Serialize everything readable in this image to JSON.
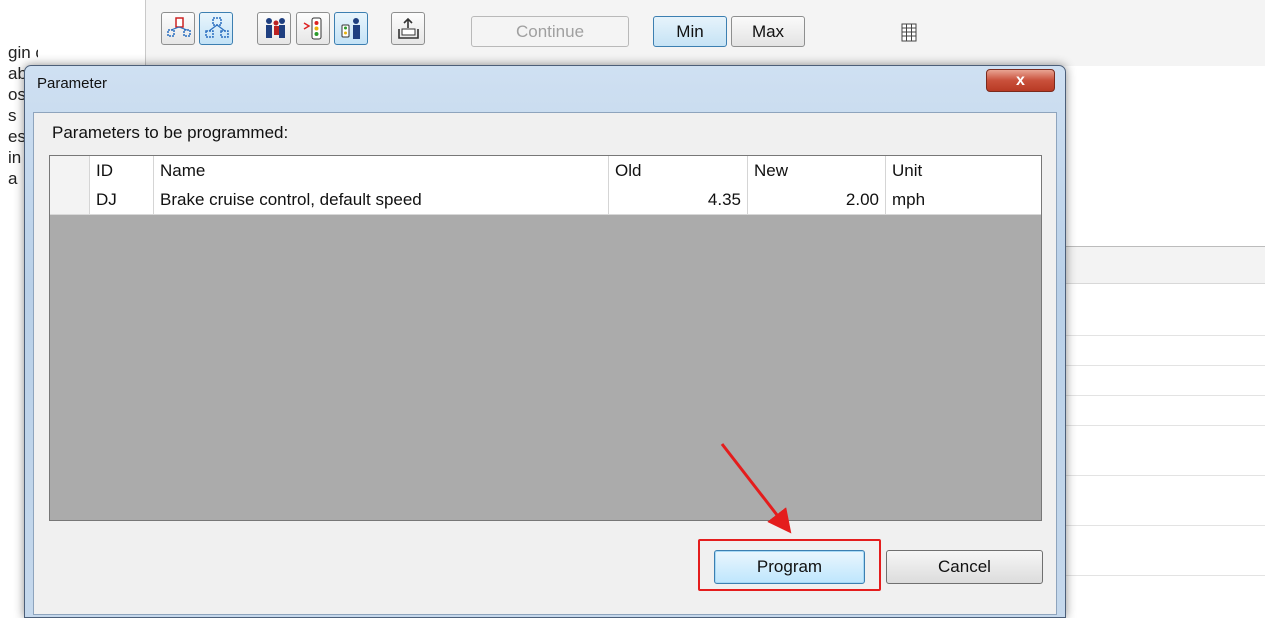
{
  "toolbar": {
    "continue_label": "Continue",
    "min_label": "Min",
    "max_label": "Max",
    "icons": [
      "flow-chart-icon",
      "flow-chart-dots-icon",
      "people-icon",
      "traffic-light-icon",
      "person-signal-icon",
      "upload-icon",
      "grid-table-icon"
    ]
  },
  "background": {
    "left_text_lines": [
      "gin operation",
      "ab",
      "os",
      "s",
      "es",
      "in",
      "a"
    ]
  },
  "dialog": {
    "title": "Parameter",
    "close_label": "x",
    "params_label": "Parameters to be programmed:",
    "columns": [
      "ID",
      "Name",
      "Old",
      "New",
      "Unit"
    ],
    "rows": [
      {
        "id": "DJ",
        "name": "Brake cruise control, default speed",
        "old": "4.35",
        "new": "2.00",
        "unit": "mph"
      }
    ],
    "program_label": "Program",
    "cancel_label": "Cancel"
  },
  "colors": {
    "highlight": "#e41d1d",
    "accent": "#3c7fb1",
    "grid_empty": "#ababab"
  }
}
